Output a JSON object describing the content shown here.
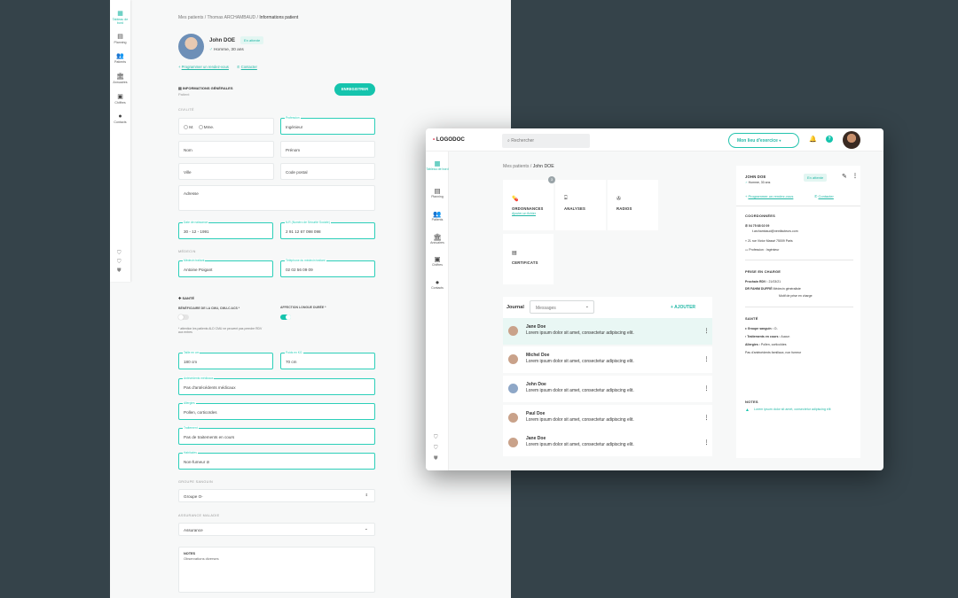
{
  "form": {
    "sidebar": [
      {
        "label": "Tableau de bord",
        "icon": "dashboard-icon"
      },
      {
        "label": "Planning",
        "icon": "calendar-icon"
      },
      {
        "label": "Patients",
        "icon": "users-icon"
      },
      {
        "label": "Annuaires",
        "icon": "building-icon"
      },
      {
        "label": "Chiffres",
        "icon": "chart-icon"
      },
      {
        "label": "Contacts",
        "icon": "contact-icon"
      }
    ],
    "breadcrumb": {
      "root": "Mes patients",
      "patient": "Thomas ARCHAMBAUD",
      "current": "Informations patient"
    },
    "patient": {
      "name": "John DOE",
      "status": "En attente",
      "gender_age": "Homme, 30 ans"
    },
    "actions": {
      "appointment": "Programmer un rendez-vous",
      "contact": "Contacter"
    },
    "section_title": "INFORMATIONS GÉNÉRALES",
    "section_sub": "Patient",
    "save_button": "ENREGISTRER",
    "civilite": {
      "heading": "CIVILITÉ",
      "m": "M.",
      "mme": "Mme."
    },
    "fields": {
      "profession": {
        "label": "Profession",
        "value": "Ingénieur"
      },
      "nom": "Nom",
      "prenom": "Prénom",
      "ville": "Ville",
      "code_postal": "Code postal",
      "adresse": "Adresse",
      "naissance": {
        "label": "Date de naissance",
        "value": "30 - 12 - 1991"
      },
      "secu": {
        "label": "N.R (Numéro de Sécurité Sociale)",
        "value": "2 91 12 67 098 098"
      }
    },
    "medecin": {
      "heading": "MÉDECIN",
      "name": {
        "label": "Médecin traitant",
        "value": "Antoine Poigant"
      },
      "phone": {
        "label": "Téléphone du médecin traitant",
        "value": "02 02 56 09 09"
      }
    },
    "sante": {
      "heading": "SANTÉ",
      "cmu_label": "BÉNÉFICIAIRE DE LA CMU, CMU-C ACS *",
      "ald_label": "AFFECTION LONGUE DURÉE *",
      "note": "* attention les patients ALD CMU ne peuvent pas prendre RDV aux entres",
      "taille": {
        "label": "Taille en cm",
        "value": "180 cm"
      },
      "poids": {
        "label": "Poids en KG",
        "value": "70 cm"
      },
      "antecedents": {
        "label": "Antécédents médicaux",
        "value": "Pas d'antécédents médicaux"
      },
      "allergies": {
        "label": "Allergies",
        "value": "Pollen, corticoïdes"
      },
      "traitement": {
        "label": "Traitement",
        "value": "Pas de traitements en cours"
      },
      "habitudes": {
        "label": "Habitudes",
        "value": "Non-fumeur"
      }
    },
    "groupe_sanguin": {
      "heading": "GROUPE SANGUIN",
      "value": "Groupe O-"
    },
    "assurance": {
      "heading": "ASSURANCE MALADIE",
      "value": "Assurance"
    },
    "notes": {
      "heading": "NOTES",
      "value": "Observations diverses"
    }
  },
  "app": {
    "logo": "LOGODOC",
    "search_placeholder": "Rechercher",
    "workplace": "Mon lieu d'exercice",
    "sidebar": [
      {
        "label": "Tableau de bord",
        "icon": "dashboard-icon"
      },
      {
        "label": "Planning",
        "icon": "calendar-icon"
      },
      {
        "label": "Patients",
        "icon": "users-icon"
      },
      {
        "label": "Annuaires",
        "icon": "building-icon"
      },
      {
        "label": "Chiffres",
        "icon": "chart-icon"
      },
      {
        "label": "Contacts",
        "icon": "contact-icon"
      }
    ],
    "breadcrumb": {
      "root": "Mes patients",
      "current": "John DOE"
    },
    "tiles": [
      {
        "title": "ORDONNANCES",
        "sub": "Ajouter un fichier",
        "badge": "3",
        "icon": "pill-icon"
      },
      {
        "title": "ANALYSES",
        "sub": "",
        "badge": "",
        "icon": "lab-icon"
      },
      {
        "title": "RADIOS",
        "sub": "",
        "badge": "",
        "icon": "xray-icon"
      },
      {
        "title": "CERTIFICATS",
        "sub": "",
        "badge": "",
        "icon": "file-icon"
      }
    ],
    "journal": {
      "title": "Journal",
      "filter": "Messages",
      "add": "+ AJOUTER",
      "entries": [
        {
          "name": "Jane Doe",
          "msg": "Lorem ipsum dolor sit amet, consectetur adipiscing elit."
        },
        {
          "name": "Michel Doe",
          "msg": "Lorem ipsum dolor sit amet, consectetur adipiscing elit."
        },
        {
          "name": "John Doe",
          "msg": "Lorem ipsum dolor sit amet, consectetur adipiscing elit."
        },
        {
          "name": "Paul Doe",
          "msg": "Lorem ipsum dolor sit amet, consectetur adipiscing elit."
        },
        {
          "name": "Jane Doe",
          "msg": "Lorem ipsum dolor sit amet, consectetur adipiscing elit."
        }
      ]
    },
    "panel": {
      "name": "JOHN DOE",
      "status": "En attente",
      "gender_age": "Homme, 30 ans",
      "appointment": "Programmer un rendez-vous",
      "contact": "Contacter",
      "coords_heading": "COORDONNÉES",
      "phone": "04 75 68 02 09",
      "email": "t.archambaud@nextfacteurs.com",
      "address": "21 rue Victor Massé 75009 Paris",
      "profession_label": "Profession :",
      "profession_value": "Ingénieur",
      "prise_heading": "PRISE EN CHARGE",
      "rdv_label": "Prochain RDV :",
      "rdv_value": "21/03/21",
      "doctor_label": "DR FAHIM DUFFIÉ",
      "doctor_role": "Médecin généraliste",
      "doctor_motif": "Motif de prise en charge",
      "sante_heading": "SANTÉ",
      "blood_label": "Groupe sanguin :",
      "blood_value": "O-",
      "treatment_label": "Traitements en cours :",
      "treatment_value": "Aucun",
      "allergies_label": "Allergies :",
      "allergies_value": "Pollen, corticoïdes",
      "history": "Pas d'antécédents familiaux, non fumeur",
      "notes_heading": "NOTES",
      "note_text": "Lorem ipsum dolor sit amet, consectetur adipiscing elit"
    }
  }
}
